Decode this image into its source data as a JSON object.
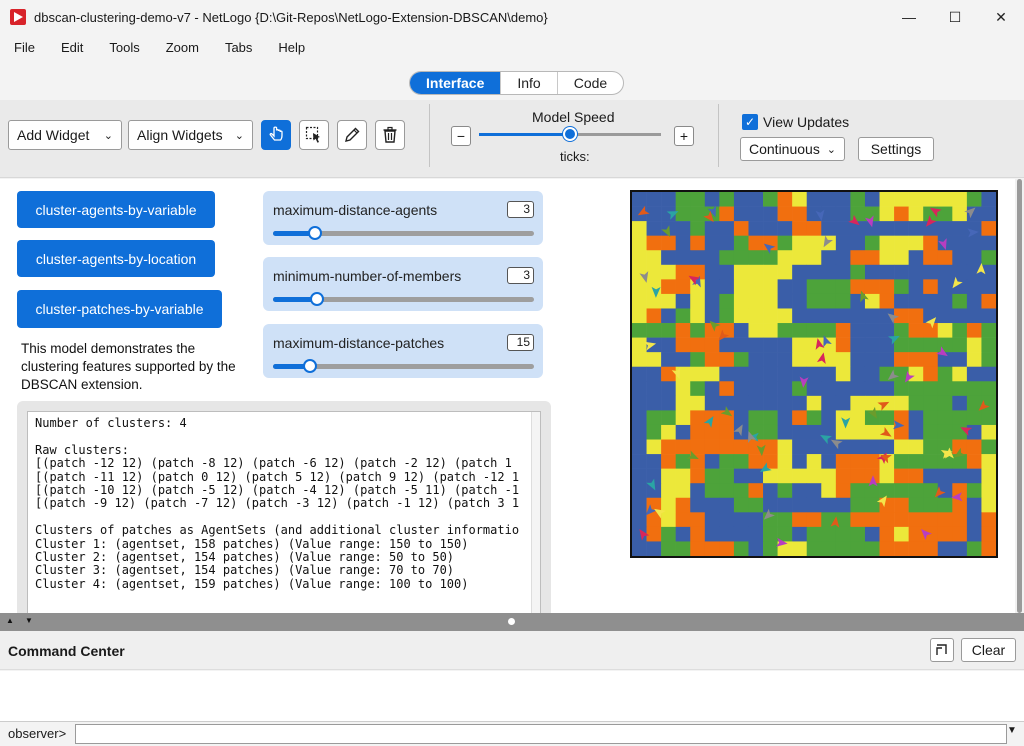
{
  "window": {
    "title": "dbscan-clustering-demo-v7 - NetLogo {D:\\Git-Repos\\NetLogo-Extension-DBSCAN\\demo}",
    "minimize": "—",
    "maximize": "☐",
    "close": "✕"
  },
  "menu": {
    "file": "File",
    "edit": "Edit",
    "tools": "Tools",
    "zoom": "Zoom",
    "tabs": "Tabs",
    "help": "Help"
  },
  "tabs": {
    "interface": "Interface",
    "info": "Info",
    "code": "Code"
  },
  "toolbar": {
    "add_widget": "Add Widget",
    "align_widgets": "Align Widgets",
    "model_speed": "Model Speed",
    "minus": "−",
    "plus": "+",
    "ticks": "ticks:",
    "view_updates": "View Updates",
    "update_mode": "Continuous",
    "settings": "Settings"
  },
  "buttons": {
    "by_variable": "cluster-agents-by-variable",
    "by_location": "cluster-agents-by-location",
    "patches_by_variable": "cluster-patches-by-variable"
  },
  "sliders": [
    {
      "label": "maximum-distance-agents",
      "value": "3",
      "fraction": 0.16
    },
    {
      "label": "minimum-number-of-members",
      "value": "3",
      "fraction": 0.17
    },
    {
      "label": "maximum-distance-patches",
      "value": "15",
      "fraction": 0.14
    }
  ],
  "note": "This model demonstrates the clustering features supported by the DBSCAN extension.",
  "output_text": "Number of clusters: 4\n\nRaw clusters:\n[(patch -12 12) (patch -8 12) (patch -6 12) (patch -2 12) (patch 1\n[(patch -11 12) (patch 0 12) (patch 5 12) (patch 9 12) (patch -12 1\n[(patch -10 12) (patch -5 12) (patch -4 12) (patch -5 11) (patch -1\n[(patch -9 12) (patch -7 12) (patch -3 12) (patch -1 12) (patch 3 1\n\nClusters of patches as AgentSets (and additional cluster informatio\nCluster 1: (agentset, 158 patches) (Value range: 150 to 150)\nCluster 2: (agentset, 154 patches) (Value range: 50 to 50)\nCluster 3: (agentset, 154 patches) (Value range: 70 to 70)\nCluster 4: (agentset, 159 patches) (Value range: 100 to 100)",
  "world": {
    "palette": [
      "#f16f0f",
      "#ece83a",
      "#4da33a",
      "#3a5ea8"
    ],
    "turtle_colors": [
      "#d8265b",
      "#b83ec0",
      "#2aa4a4",
      "#8c8c8c",
      "#e05a1a",
      "#f4e64b",
      "#4667b8",
      "#6b9c2c"
    ]
  },
  "command_center": {
    "title": "Command Center",
    "clear": "Clear",
    "observer": "observer>",
    "input_value": ""
  }
}
